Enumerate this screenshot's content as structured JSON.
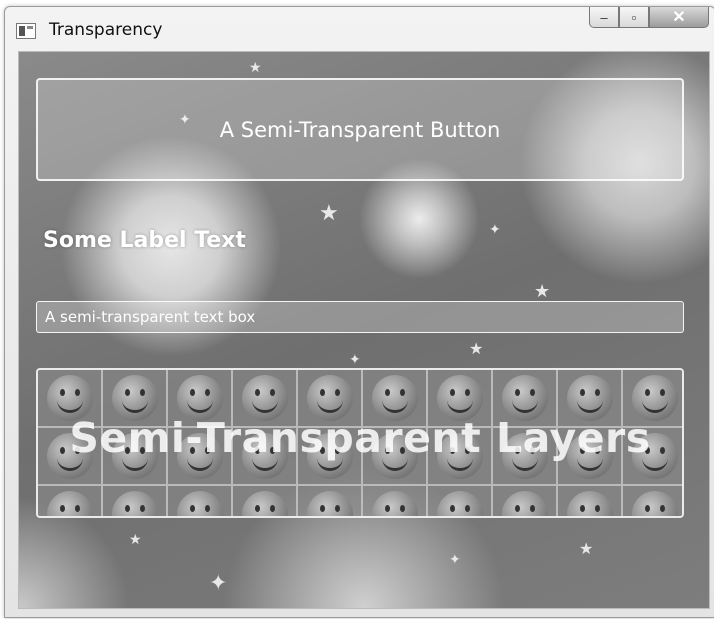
{
  "window": {
    "title": "Transparency",
    "app_icon": "window-app-icon",
    "controls": {
      "minimize": "–",
      "maximize": "▫",
      "close": "✕"
    }
  },
  "content": {
    "button_label": "A Semi-Transparent Button",
    "label_text": "Some Label Text",
    "textbox_value": "A semi-transparent text box",
    "layers_text": "Semi-Transparent Layers",
    "smiley_icon": "smiley-icon"
  },
  "colors": {
    "overlay_white": "#ffffff",
    "background_dark": "#7a7a7a"
  }
}
